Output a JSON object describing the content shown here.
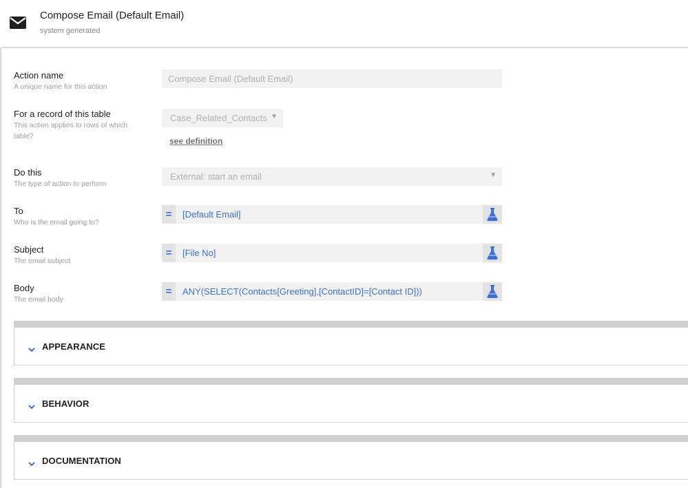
{
  "header": {
    "icon": "envelope-icon",
    "title": "Compose Email (Default Email)",
    "subtitle": "system generated"
  },
  "form": {
    "action_name": {
      "label": "Action name",
      "description": "A unique name for this action",
      "value": "Compose Email (Default Email)"
    },
    "table": {
      "label": "For a record of this table",
      "description_line1": "This action applies to rows of which",
      "description_line2": "table?",
      "value": "Case_Related_Contacts",
      "arrow": "▼",
      "link": "see definition"
    },
    "do_this": {
      "label": "Do this",
      "description": "The type of action to perform",
      "value": "External: start an email",
      "arrow": "▼"
    },
    "to": {
      "label": "To",
      "description": "Who is the email going to?",
      "prefix": "=",
      "value": "[Default Email]"
    },
    "subject": {
      "label": "Subject",
      "description": "The email subject",
      "prefix": "=",
      "value": "[File No]"
    },
    "body": {
      "label": "Body",
      "description": "The email body",
      "prefix": "=",
      "value": "ANY(SELECT(Contacts[Greeting],[ContactID]=[Contact ID]))"
    }
  },
  "sections": {
    "appearance": "APPEARANCE",
    "behavior": "BEHAVIOR",
    "documentation": "DOCUMENTATION"
  },
  "colors": {
    "accent": "#3d6fd8",
    "field_bg": "#f2f2f2",
    "divider": "#cfcfcf"
  }
}
